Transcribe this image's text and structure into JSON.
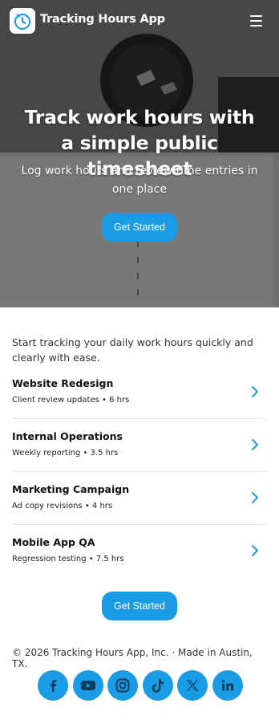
{
  "header": {
    "app_name": "Tracking Hours App",
    "logo_icon": "stopwatch-icon",
    "menu_icon": "hamburger-menu-icon"
  },
  "hero": {
    "title": "Track work hours with a simple public timesheet",
    "subtitle": "Log work hours and review time entries in one place",
    "cta_label": "Get Started"
  },
  "intro_text": "Start tracking your daily work hours quickly and clearly with ease.",
  "entries": [
    {
      "title": "Website Redesign",
      "detail": "Client review updates • 6 hrs"
    },
    {
      "title": "Internal Operations",
      "detail": "Weekly reporting • 3.5 hrs"
    },
    {
      "title": "Marketing Campaign",
      "detail": "Ad copy revisions • 4 hrs"
    },
    {
      "title": "Mobile App QA",
      "detail": "Regression testing • 7.5 hrs"
    }
  ],
  "bottom_cta_label": "Get Started",
  "footer": {
    "copyright": "© 2026 Tracking Hours App, Inc. · Made in Austin, TX."
  },
  "socials": [
    "facebook-icon",
    "youtube-icon",
    "instagram-icon",
    "tiktok-icon",
    "x-icon",
    "linkedin-icon"
  ],
  "colors": {
    "accent": "#1a9be6",
    "text": "#1a1a1a",
    "divider": "#e4e4e4"
  }
}
